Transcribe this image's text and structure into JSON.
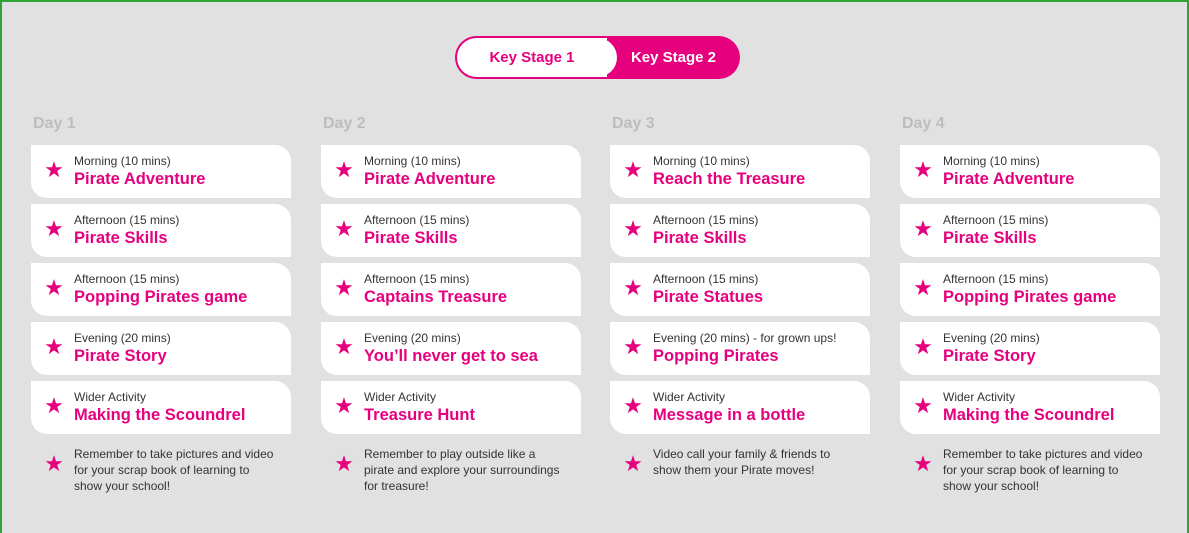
{
  "toggle": {
    "ks1_label": "Key Stage 1",
    "ks2_label": "Key Stage 2",
    "accent": "#e6007e"
  },
  "icons": {
    "activity": "star-icon"
  },
  "days": [
    {
      "label": "Day 1",
      "activities": [
        {
          "time": "Morning (10 mins)",
          "title": "Pirate Adventure"
        },
        {
          "time": "Afternoon (15 mins)",
          "title": "Pirate Skills"
        },
        {
          "time": "Afternoon (15 mins)",
          "title": "Popping Pirates game"
        },
        {
          "time": "Evening (20 mins)",
          "title": "Pirate Story"
        },
        {
          "time": "Wider Activity",
          "title": "Making the Scoundrel"
        }
      ],
      "note": "Remember to take pictures and video for your scrap book of learning to show your school!"
    },
    {
      "label": "Day 2",
      "activities": [
        {
          "time": "Morning (10 mins)",
          "title": "Pirate Adventure"
        },
        {
          "time": "Afternoon (15 mins)",
          "title": "Pirate Skills"
        },
        {
          "time": "Afternoon (15 mins)",
          "title": "Captains Treasure"
        },
        {
          "time": "Evening (20 mins)",
          "title": "You’ll never get to sea"
        },
        {
          "time": "Wider Activity",
          "title": "Treasure Hunt"
        }
      ],
      "note": "Remember to play outside like a pirate and explore your surroundings for treasure!"
    },
    {
      "label": "Day 3",
      "activities": [
        {
          "time": "Morning (10 mins)",
          "title": "Reach the Treasure"
        },
        {
          "time": "Afternoon (15 mins)",
          "title": "Pirate Skills"
        },
        {
          "time": "Afternoon (15 mins)",
          "title": "Pirate Statues"
        },
        {
          "time": "Evening (20 mins) - for grown ups!",
          "title": "Popping Pirates"
        },
        {
          "time": "Wider Activity",
          "title": "Message in a bottle"
        }
      ],
      "note": "Video call your family & friends to show them your Pirate moves!"
    },
    {
      "label": "Day 4",
      "activities": [
        {
          "time": "Morning (10 mins)",
          "title": "Pirate Adventure"
        },
        {
          "time": "Afternoon (15 mins)",
          "title": "Pirate Skills"
        },
        {
          "time": "Afternoon (15 mins)",
          "title": "Popping Pirates game"
        },
        {
          "time": "Evening (20 mins)",
          "title": "Pirate Story"
        },
        {
          "time": "Wider Activity",
          "title": "Making the Scoundrel"
        }
      ],
      "note": "Remember to take pictures and video for your scrap book of learning to show your school!"
    }
  ]
}
